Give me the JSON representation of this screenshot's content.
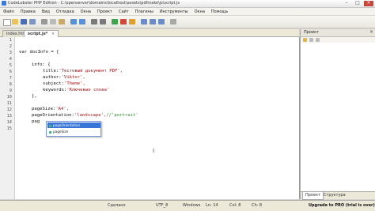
{
  "window": {
    "title": "CodeLobster PHP Edition - C:\\openserver\\domains\\localhost\\assets\\pdfmake\\js\\script.js",
    "min": "–",
    "max": "□",
    "close": "×"
  },
  "menu": [
    "Файл",
    "Правка",
    "Вид",
    "Отладка",
    "Окна",
    "Проект",
    "Сайт",
    "Плагины",
    "Инструменты",
    "Окна",
    "Помощь"
  ],
  "tabs": [
    {
      "label": "index.html"
    },
    {
      "label": "script.js*"
    }
  ],
  "tab_close": "×",
  "line_numbers": [
    "1",
    "2",
    "3",
    "4",
    "5",
    "6",
    "7",
    "8",
    "9",
    "10",
    "11",
    "12",
    "13",
    "14",
    "15"
  ],
  "code": {
    "l3": "var docInfo = {",
    "l5a": "info: {",
    "l6k": "title:",
    "l6s": "'Тестовый документ PDF',",
    "l7k": "author:",
    "l7s": "'Viktor',",
    "l8k": "subject:",
    "l8s": "'Theme',",
    "l9k": "keywords:",
    "l9s": "'Ключевые слова'",
    "l10": "},",
    "l12k": "pageSize:",
    "l12s": "'A4',",
    "l13k": "pageOrientation:",
    "l13s": "'landscape',",
    "l13c": "//'portrait'",
    "l14": "pag"
  },
  "autocomplete": [
    {
      "label": "pageOrientation"
    },
    {
      "label": "pageSize"
    }
  ],
  "mouse_cursor": "I",
  "right_panel": {
    "title": "Проект",
    "close": "×",
    "tabs": [
      "Проект",
      "Структура"
    ]
  },
  "status": {
    "saved": "Сделано",
    "encoding": "UTF_8",
    "line_ending": "Windows",
    "ln": "Ln: 14",
    "col": "Col: 8",
    "ch": "Ch: 8",
    "upgrade": "Upgrade to PRO (trial is over)"
  }
}
